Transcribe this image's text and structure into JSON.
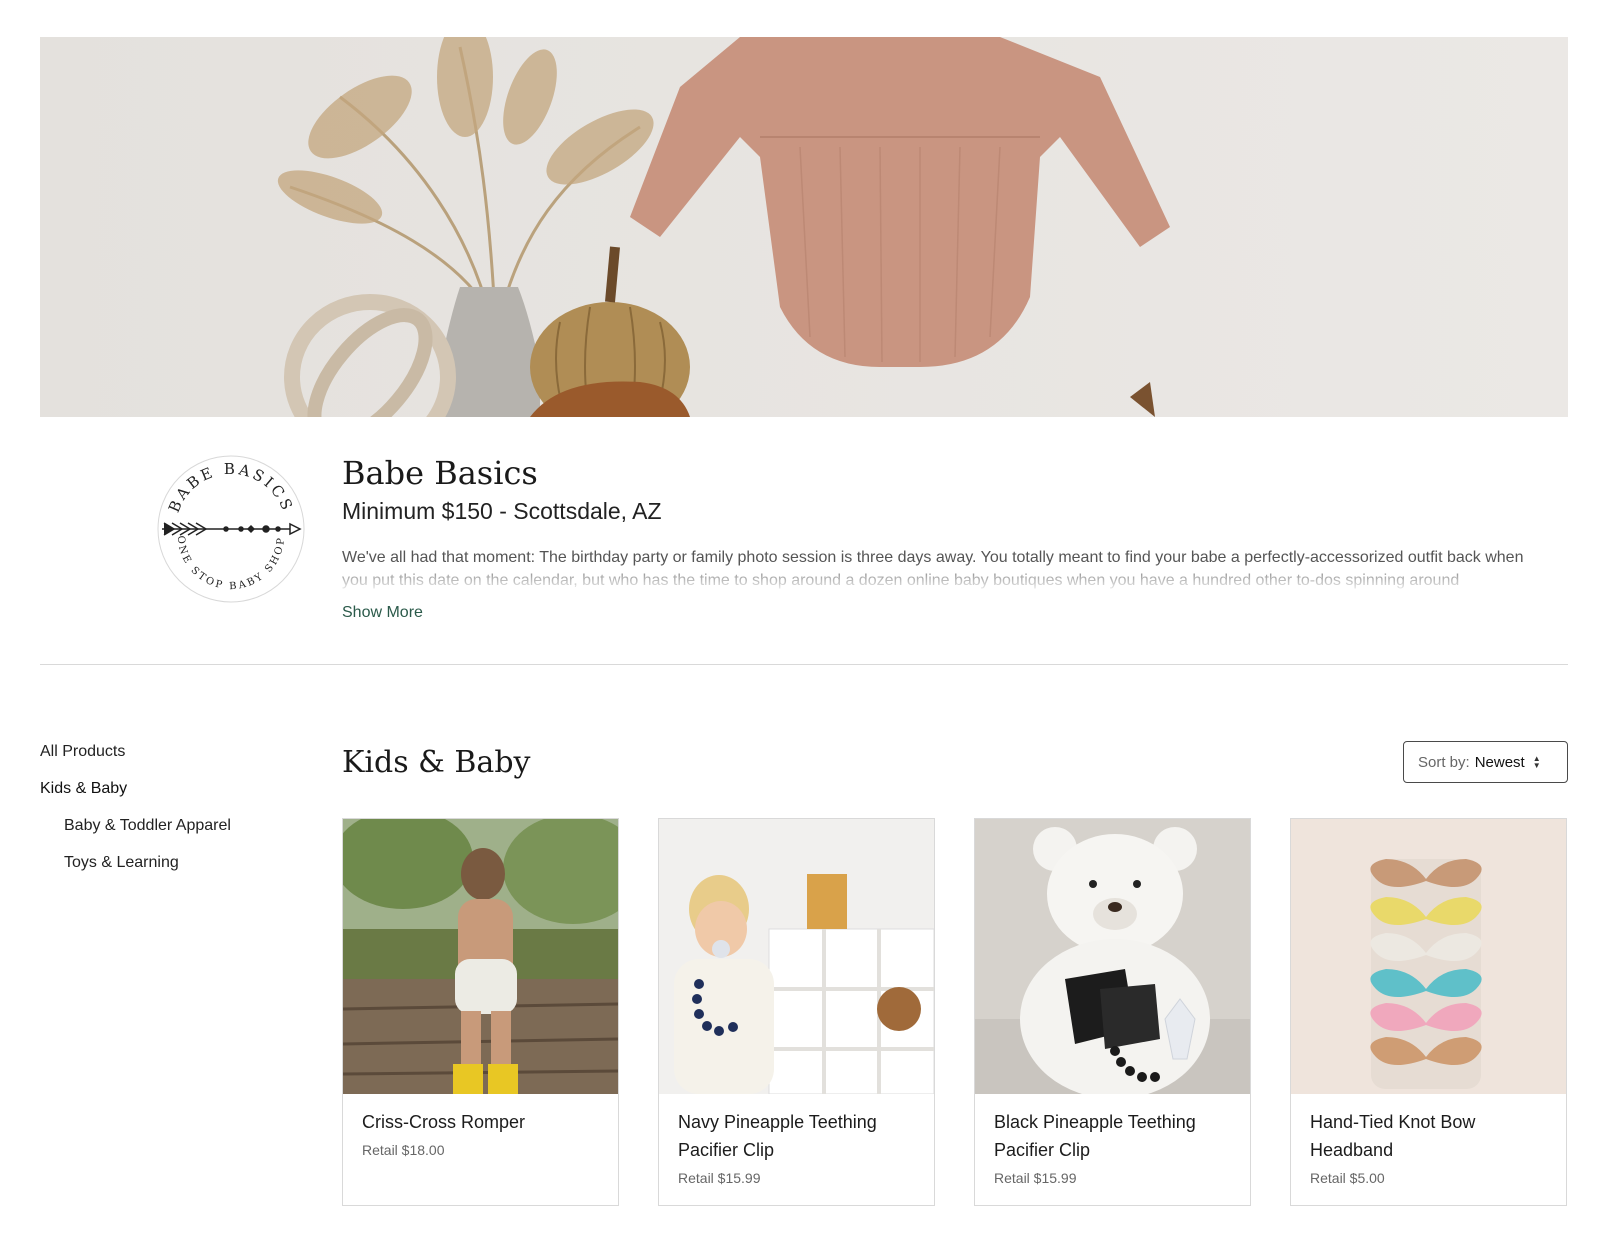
{
  "banner": {
    "alt_icon": "banner-photo"
  },
  "brand": {
    "logo_icon": "babe-basics-logo-icon",
    "logo_text_top": "BABE BASICS",
    "logo_text_bottom": "ONE STOP BABY SHOP",
    "name": "Babe Basics",
    "subtitle": "Minimum $150 - Scottsdale, AZ",
    "description": "We've all had that moment: The birthday party or family photo session is three days away. You totally meant to find your babe a perfectly-accessorized outfit back when you put this date on the calendar, but who has the time to shop around a dozen online baby boutiques when you have a hundred other to-dos spinning around",
    "show_more": "Show More"
  },
  "sidebar": {
    "items": [
      {
        "label": "All Products"
      },
      {
        "label": "Kids & Baby"
      },
      {
        "label": "Baby & Toddler Apparel"
      },
      {
        "label": "Toys & Learning"
      }
    ]
  },
  "main": {
    "title": "Kids & Baby",
    "sort": {
      "label": "Sort by:",
      "value": "Newest",
      "icon": "sort-arrows-icon"
    },
    "products": [
      {
        "name": "Criss-Cross Romper",
        "price": "Retail $18.00"
      },
      {
        "name": "Navy Pineapple Teething Pacifier Clip",
        "price": "Retail $15.99"
      },
      {
        "name": "Black Pineapple Teething Pacifier Clip",
        "price": "Retail $15.99"
      },
      {
        "name": "Hand-Tied Knot Bow Headband",
        "price": "Retail $5.00"
      }
    ]
  },
  "colors": {
    "accent_link": "#2b5a4a",
    "divider": "#d9d9d9"
  }
}
